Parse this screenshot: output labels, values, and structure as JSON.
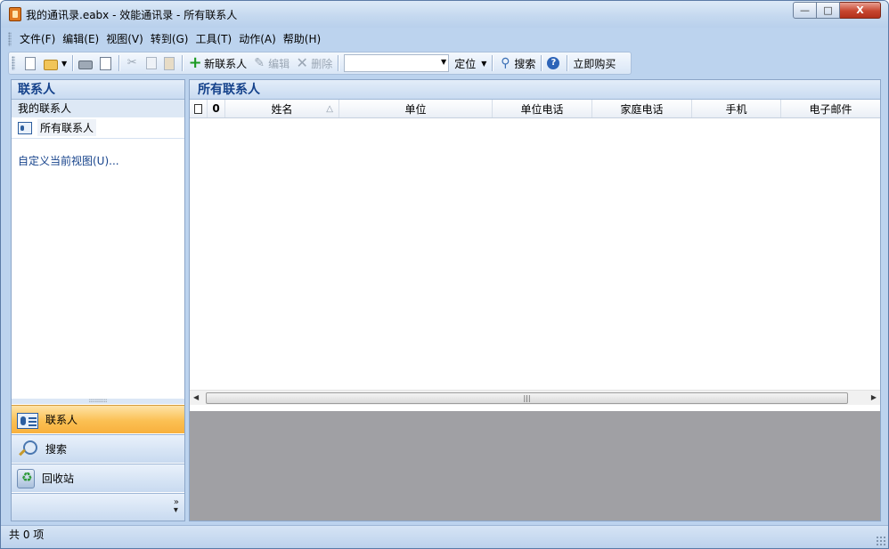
{
  "window": {
    "title": "我的通讯录.eabx - 效能通讯录 - 所有联系人",
    "min_label": "—",
    "max_label": "□",
    "close_label": "X"
  },
  "menubar": {
    "items": [
      "文件(F)",
      "编辑(E)",
      "视图(V)",
      "转到(G)",
      "工具(T)",
      "动作(A)",
      "帮助(H)"
    ]
  },
  "toolbar": {
    "new_contact_label": "新联系人",
    "edit_label": "编辑",
    "delete_label": "删除",
    "locate_label": "定位",
    "search_label": "搜索",
    "buy_label": "立即购买",
    "combo_value": ""
  },
  "left_pane": {
    "header": "联系人",
    "section": "我的联系人",
    "items": [
      {
        "label": "所有联系人",
        "icon": "contact-card-icon"
      }
    ],
    "customize_link": "自定义当前视图(U)..."
  },
  "nav_buttons": [
    {
      "label": "联系人",
      "icon": "contacts-icon",
      "active": true
    },
    {
      "label": "搜索",
      "icon": "search-icon",
      "active": false
    },
    {
      "label": "回收站",
      "icon": "recycle-bin-icon",
      "active": false
    }
  ],
  "main_pane": {
    "header": "所有联系人",
    "columns": [
      "姓名",
      "单位",
      "单位电话",
      "家庭电话",
      "手机",
      "电子邮件"
    ],
    "rows": []
  },
  "status": {
    "text": "共 0 项"
  },
  "colors": {
    "accent": "#15428b",
    "active_nav": "#fbc053",
    "chrome": "#bcd3ee",
    "preview_gray": "#a0a0a4"
  }
}
